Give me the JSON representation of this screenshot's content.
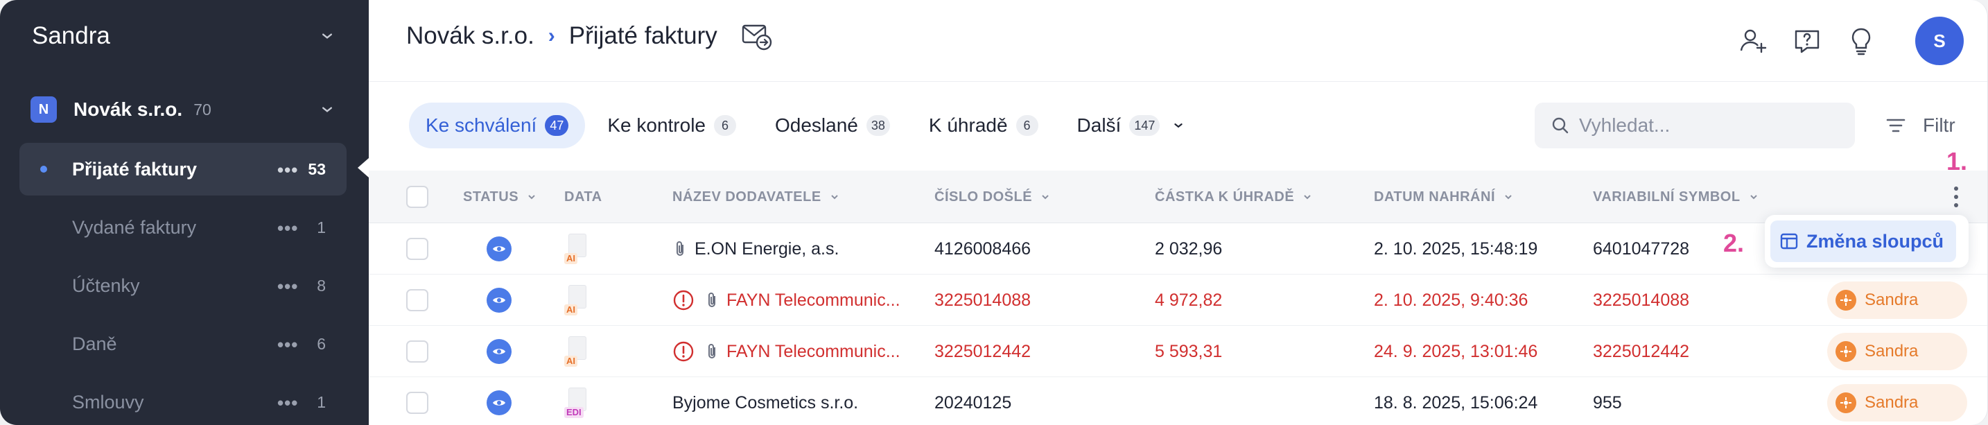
{
  "sidebar": {
    "user_name": "Sandra",
    "org": {
      "badge": "N",
      "name": "Novák s.r.o.",
      "count": "70"
    },
    "items": [
      {
        "label": "Přijaté faktury",
        "more": "•••",
        "count": "53",
        "active": true
      },
      {
        "label": "Vydané faktury",
        "more": "•••",
        "count": "1"
      },
      {
        "label": "Účtenky",
        "more": "•••",
        "count": "8"
      },
      {
        "label": "Daně",
        "more": "•••",
        "count": "6"
      },
      {
        "label": "Smlouvy",
        "more": "•••",
        "count": "1"
      }
    ]
  },
  "header": {
    "breadcrumb_org": "Novák s.r.o.",
    "breadcrumb_sep": "›",
    "breadcrumb_page": "Přijaté faktury",
    "avatar_initial": "S",
    "icons": [
      "add-user-icon",
      "help-icon",
      "lightbulb-icon"
    ]
  },
  "tabs": [
    {
      "label": "Ke schválení",
      "count": "47",
      "active": true
    },
    {
      "label": "Ke kontrole",
      "count": "6"
    },
    {
      "label": "Odeslané",
      "count": "38"
    },
    {
      "label": "K úhradě",
      "count": "6"
    },
    {
      "label": "Další",
      "count": "147"
    }
  ],
  "search": {
    "placeholder": "Vyhledat..."
  },
  "filter_label": "Filtr",
  "columns": [
    "STATUS",
    "DATA",
    "NÁZEV DODAVATELE",
    "ČÍSLO DOŠLÉ",
    "ČÁSTKA K ÚHRADĚ",
    "DATUM NAHRÁNÍ",
    "VARIABILNÍ SYMBOL"
  ],
  "rows": [
    {
      "doc_tag": "AI",
      "warning": false,
      "attachment": true,
      "supplier": "E.ON Energie, a.s.",
      "number": "4126008466",
      "amount": "2 032,96",
      "uploaded": "2. 10. 2025, 15:48:19",
      "vs": "6401047728",
      "assignee": "",
      "highlight": false
    },
    {
      "doc_tag": "AI",
      "warning": true,
      "attachment": true,
      "supplier": "FAYN Telecommunic...",
      "number": "3225014088",
      "amount": "4 972,82",
      "uploaded": "2. 10. 2025, 9:40:36",
      "vs": "3225014088",
      "assignee": "Sandra",
      "highlight": true
    },
    {
      "doc_tag": "AI",
      "warning": true,
      "attachment": true,
      "supplier": "FAYN Telecommunic...",
      "number": "3225012442",
      "amount": "5 593,31",
      "uploaded": "24. 9. 2025, 13:01:46",
      "vs": "3225012442",
      "assignee": "Sandra",
      "highlight": true
    },
    {
      "doc_tag": "EDI",
      "warning": false,
      "attachment": false,
      "supplier": "Byjome Cosmetics s.r.o.",
      "number": "20240125",
      "amount": "",
      "uploaded": "18. 8. 2025, 15:06:24",
      "vs": "955",
      "assignee": "Sandra",
      "highlight": false
    }
  ],
  "annotations": {
    "step1": "1.",
    "step2": "2."
  },
  "popover": {
    "label": "Změna sloupců"
  },
  "colors": {
    "accent": "#3d63dd",
    "danger": "#d12f2f",
    "assignee": "#e57a2a",
    "annotation": "#e04a9a"
  }
}
